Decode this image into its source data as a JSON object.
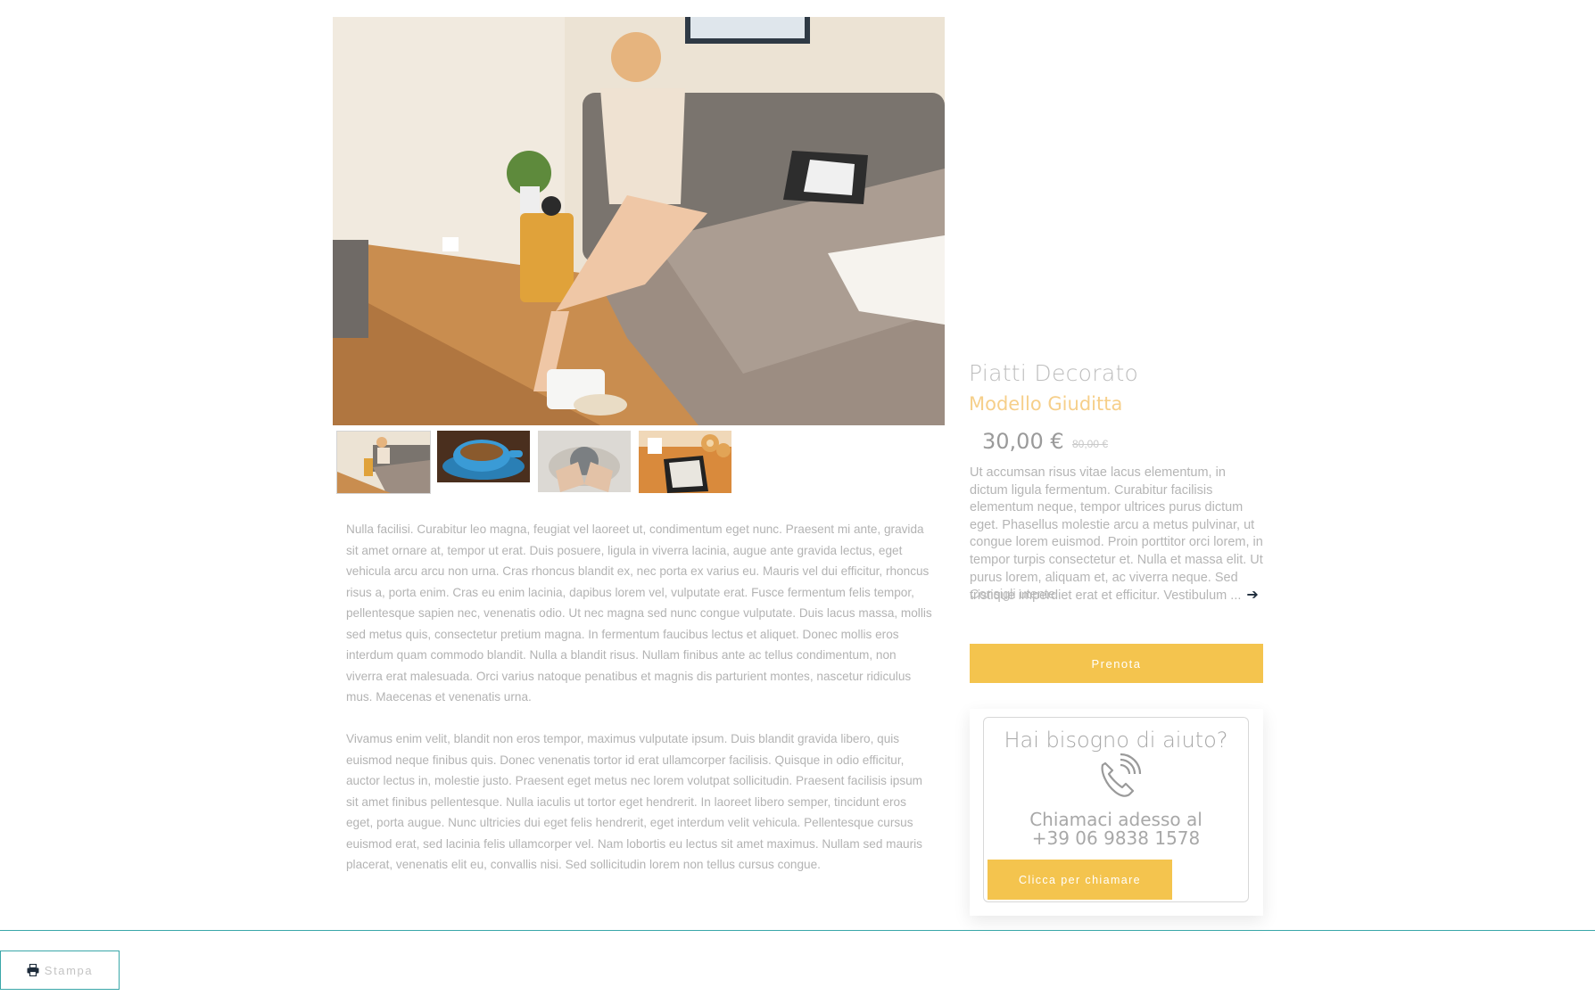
{
  "product": {
    "title": "Piatti Decorato",
    "subtitle": "Modello Giuditta",
    "price": "30,00 €",
    "old_price": "80,00 €",
    "short_description": "Ut accumsan risus vitae lacus elementum, in dictum ligula fermentum. Curabitur facilisis elementum neque, tempor ultrices purus dictum eget. Phasellus molestie arcu a metus pulvinar, ut congue lorem euismod. Proin porttitor orci lorem, in tempor turpis consectetur et. Nulla et massa elit. Ut purus lorem, aliquam et, ac viverra neque. Sed tristique imperdiet erat et efficitur. Vestibulum ...",
    "overlap_label": "Consigli utente",
    "arrow_icon": "arrow-right-icon",
    "book_button": "Prenota"
  },
  "description": {
    "paragraphs": [
      "Nulla facilisi. Curabitur leo magna, feugiat vel laoreet ut, condimentum eget nunc. Praesent mi ante, gravida sit amet ornare at, tempor ut erat. Duis posuere, ligula in viverra lacinia, augue ante gravida lectus, eget vehicula arcu arcu non urna. Cras rhoncus blandit ex, nec porta ex varius eu. Mauris vel dui efficitur, rhoncus risus a, porta enim. Cras eu enim lacinia, dapibus lorem vel, vulputate erat. Fusce fermentum felis tempor, pellentesque sapien nec, venenatis odio. Ut nec magna sed nunc congue vulputate. Duis lacus massa, mollis sed metus quis, consectetur pretium magna. In fermentum faucibus lectus et aliquet. Donec mollis eros interdum quam commodo blandit. Nulla a blandit risus. Nullam finibus ante ac tellus condimentum, non viverra erat malesuada. Orci varius natoque penatibus et magnis dis parturient montes, nascetur ridiculus mus. Maecenas et venenatis urna.",
      "Vivamus enim velit, blandit non eros tempor, maximus vulputate ipsum. Duis blandit gravida libero, quis euismod neque finibus quis. Donec venenatis tortor id erat ullamcorper facilisis. Quisque in odio efficitur, auctor lectus in, molestie justo. Praesent eget metus nec lorem volutpat sollicitudin. Praesent facilisis ipsum sit amet finibus pellentesque. Nulla iaculis ut tortor eget hendrerit. In laoreet libero semper, tincidunt eros eget, porta augue. Nunc ultricies dui eget felis hendrerit, eget interdum velit vehicula. Pellentesque cursus euismod erat, sed lacinia felis ullamcorper vel. Nam lobortis eu lectus sit amet maximus. Nullam sed mauris placerat, venenatis elit eu, convallis nisi. Sed sollicitudin lorem non tellus cursus congue."
    ]
  },
  "help": {
    "title": "Hai bisogno di aiuto?",
    "call_line1": "Chiamaci adesso al",
    "call_line2": "+39 06 9838 1578",
    "call_button": "Clicca per chiamare",
    "icon": "phone-icon"
  },
  "footer": {
    "print_button": "Stampa",
    "print_icon": "printer-icon"
  },
  "colors": {
    "accent": "#f4c44e",
    "subtitle": "#f6cf8a",
    "teal": "#3aa7a9"
  }
}
